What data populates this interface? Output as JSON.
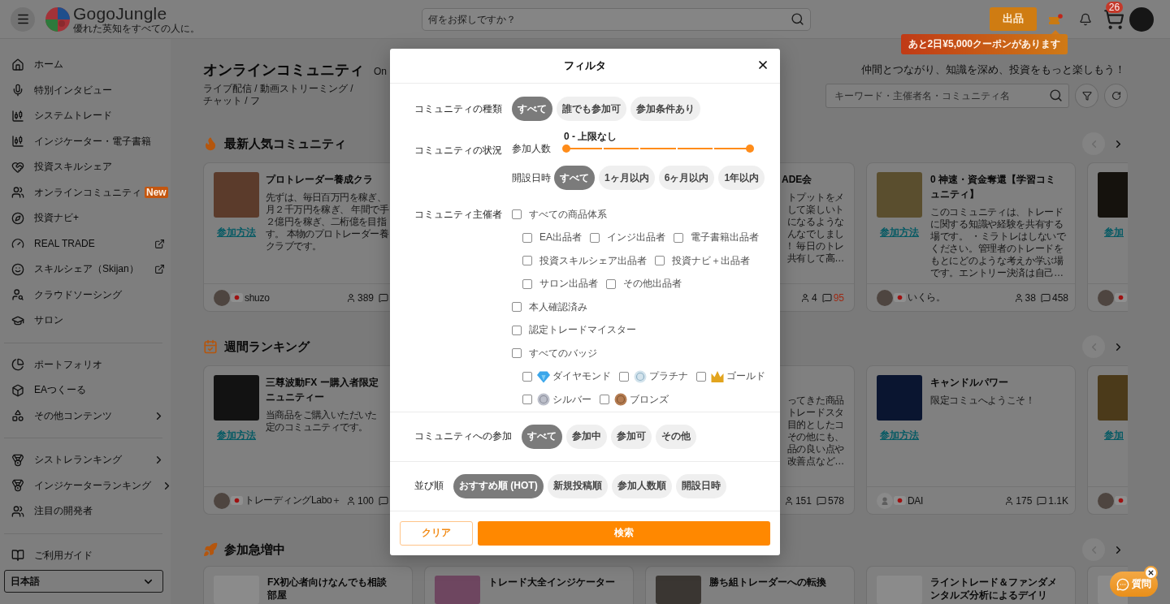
{
  "header": {
    "logo": "GogoJungle",
    "tagline": "優れた英知をすべての人に。",
    "search_placeholder": "何をお探しですか？",
    "sell_button": "出品",
    "coupon_alert": true,
    "cart_count": "26",
    "coupon_tooltip": "あと2日¥5,000クーポンがあります"
  },
  "sidebar": {
    "groups": [
      {
        "items": [
          {
            "label": "ホーム",
            "external": false,
            "submenu": false
          },
          {
            "label": "特別インタビュー",
            "external": false,
            "submenu": false
          },
          {
            "label": "システムトレード",
            "external": false,
            "submenu": false
          },
          {
            "label": "インジケーター・電子書籍",
            "external": false,
            "submenu": false
          },
          {
            "label": "投資スキルシェア",
            "external": false,
            "submenu": false
          },
          {
            "label": "オンラインコミュニティ",
            "badge": "New",
            "external": false,
            "submenu": false
          },
          {
            "label": "投資ナビ+",
            "external": false,
            "submenu": false
          },
          {
            "label": "REAL TRADE",
            "external": true,
            "submenu": false
          },
          {
            "label": "スキルシェア（Skijan）",
            "external": true,
            "submenu": false
          },
          {
            "label": "クラウドソーシング",
            "external": false,
            "submenu": false
          },
          {
            "label": "サロン",
            "external": false,
            "submenu": false
          }
        ]
      },
      {
        "items": [
          {
            "label": "ポートフォリオ",
            "external": false,
            "submenu": false
          },
          {
            "label": "EAつくーる",
            "external": false,
            "submenu": false
          },
          {
            "label": "その他コンテンツ",
            "external": false,
            "submenu": true
          }
        ]
      },
      {
        "items": [
          {
            "label": "シストレランキング",
            "external": false,
            "submenu": true
          },
          {
            "label": "インジケーターランキング",
            "external": false,
            "submenu": true
          },
          {
            "label": "注目の開発者",
            "external": false,
            "submenu": false
          }
        ]
      },
      {
        "items": [
          {
            "label": "ご利用ガイド",
            "external": false,
            "submenu": false
          }
        ]
      }
    ],
    "language": "日本語"
  },
  "page": {
    "title": "オンラインコミュニティ",
    "title_en": "On",
    "subtitle": "ライブ配信 / 動画ストリーミング / チャット / フ",
    "tagline": "仲間とつながり、知識を深め、投資をもっと楽しもう！",
    "search_placeholder": "キーワード・主催者名・コミュニティ名"
  },
  "sections": [
    {
      "title": "最新人気コミュニティ",
      "prev_disabled": true,
      "cards": [
        {
          "kind": "clip_right",
          "link": "参加方法",
          "title_lines": [
            "プロトレーダー養成クラ"
          ],
          "description_lines": [
            "先ずは、毎日百万円を稼ぎ、",
            "月２千万円を稼ぎ、 年間で手",
            "２億円を稼ぎ、二桁億を目指",
            "す。 本物のプロトレーダー養",
            "クラブです。"
          ],
          "avatar": true,
          "default_avatar": false,
          "author": "shuzo",
          "members": "389"
        },
        {
          "kind": "clip_left",
          "title_lines": [
            "ADE会"
          ],
          "description_lines": [
            "トプットをメ",
            "して楽しいト",
            "になるような",
            "んなでしまし",
            "！ 毎日のトレ",
            "共有して高…"
          ],
          "members": "4",
          "comments": "95",
          "comments_highlight": true
        },
        {
          "kind": "full",
          "link": "参加方法",
          "title_lines": [
            "0 神速・資金奪還【学習コミ",
            "ュニティ】"
          ],
          "description_lines": [
            "このコミュニティは、トレード",
            "に関する知識や経験を共有する",
            "場です。 ・ミラトレはしないで",
            "ください。管理者のトレードを",
            "もとにどのような考えか学ぶ場",
            "です。エントリー決済は自己…"
          ],
          "avatar": true,
          "default_avatar": false,
          "author": "いくら。",
          "members": "38",
          "comments": "458",
          "comments_highlight": false
        },
        {
          "kind": "edge",
          "link": "参加",
          "avatar": true,
          "default_avatar": false
        }
      ]
    },
    {
      "title": "週間ランキング",
      "prev_disabled": true,
      "cards": [
        {
          "kind": "clip_right",
          "link": "参加方法",
          "title_lines": [
            "三尊波動FX ー購入者限定",
            "ニュニティー"
          ],
          "description_lines": [
            "当商品をご購入いただいた",
            "定のコミュニティです。"
          ],
          "avatar": true,
          "default_avatar": false,
          "author": "トレーディングLabo＋",
          "members": "100"
        },
        {
          "kind": "clip_left",
          "description_lines": [
            "ってきた商品",
            "トレードスタ",
            "目的としたコ",
            "その他にも、",
            "品の良い点や",
            "改善点など…"
          ],
          "members": "151",
          "comments": "578",
          "comments_highlight": false
        },
        {
          "kind": "full",
          "link": "参加方法",
          "title_lines": [
            "キャンドルパワー"
          ],
          "description_lines": [
            "限定コミュへようこそ！"
          ],
          "avatar": true,
          "default_avatar": true,
          "author": "DAI",
          "members": "175",
          "comments": "1.1K",
          "comments_highlight": false
        },
        {
          "kind": "edge",
          "link": "参加",
          "avatar": true,
          "default_avatar": false
        }
      ]
    },
    {
      "title": "参加急増中",
      "prev_disabled": true,
      "cards": [
        {
          "kind": "full",
          "title_lines": [
            "FX初心者向けなんでも相談",
            "部屋"
          ]
        },
        {
          "kind": "full",
          "title_lines": [
            "トレード大全インジケーター"
          ]
        },
        {
          "kind": "full",
          "title_lines": [
            "勝ち組トレーダーへの転換"
          ]
        },
        {
          "kind": "full",
          "title_lines": [
            "ライントレード＆ファンダメ",
            "ンタルズ分析によるデイリ"
          ]
        },
        {
          "kind": "edge"
        }
      ]
    }
  ],
  "filter": {
    "title": "フィルタ",
    "sections": [
      {
        "kind": "chips",
        "label": "コミュニティの種類",
        "options": [
          {
            "label": "すべて",
            "selected": true
          },
          {
            "label": "誰でも参加可",
            "selected": false
          },
          {
            "label": "参加条件あり",
            "selected": false
          }
        ]
      },
      {
        "kind": "status",
        "label": "コミュニティの状況",
        "range": {
          "label": "参加人数",
          "reading": "0 - 上限なし",
          "thumbs": [
            {
              "level": 0
            },
            {
              "level": 1
            }
          ]
        },
        "date": {
          "label": "開設日時",
          "options": [
            {
              "label": "すべて",
              "selected": true
            },
            {
              "label": "1ヶ月以内",
              "selected": false
            },
            {
              "label": "6ヶ月以内",
              "selected": false
            },
            {
              "label": "1年以内",
              "selected": false
            }
          ]
        }
      },
      {
        "kind": "checkboxes",
        "label": "コミュニティ主催者",
        "items": [
          {
            "kind": "plain",
            "label": "すべての商品体系",
            "checked": false,
            "children": [
              {
                "kind": "plain",
                "label": "EA出品者",
                "checked": false
              },
              {
                "kind": "plain",
                "label": "インジ出品者",
                "checked": false
              },
              {
                "kind": "plain",
                "label": "電子書籍出品者",
                "checked": false
              },
              {
                "kind": "plain",
                "label": "投資スキルシェア出品者",
                "checked": false
              },
              {
                "kind": "plain",
                "label": "投資ナビ＋出品者",
                "checked": false
              },
              {
                "kind": "plain",
                "label": "サロン出品者",
                "checked": false
              },
              {
                "kind": "plain",
                "label": "その他出品者",
                "checked": false
              }
            ]
          },
          {
            "kind": "plain",
            "label": "本人確認済み",
            "checked": false
          },
          {
            "kind": "plain",
            "label": "認定トレードマイスター",
            "checked": false
          },
          {
            "kind": "plain",
            "label": "すべてのバッジ",
            "checked": false,
            "children": [
              {
                "kind": "badge",
                "label": "ダイヤモンド",
                "checked": false
              },
              {
                "kind": "badge",
                "label": "プラチナ",
                "checked": false
              },
              {
                "kind": "badge",
                "label": "ゴールド",
                "checked": false
              },
              {
                "kind": "badge",
                "label": "シルバー",
                "checked": false
              },
              {
                "kind": "badge",
                "label": "ブロンズ",
                "checked": false
              }
            ]
          }
        ]
      }
    ],
    "bars": [
      {
        "label": "コミュニティへの参加",
        "options": [
          {
            "label": "すべて",
            "selected": true
          },
          {
            "label": "参加中",
            "selected": false
          },
          {
            "label": "参加可",
            "selected": false
          },
          {
            "label": "その他",
            "selected": false
          }
        ]
      },
      {
        "label": "並び順",
        "options": [
          {
            "label": "おすすめ順 (HOT)",
            "selected": true
          },
          {
            "label": "新規投稿順",
            "selected": false
          },
          {
            "label": "参加人数順",
            "selected": false
          },
          {
            "label": "開設日時",
            "selected": false
          }
        ]
      }
    ],
    "clear_button": "クリア",
    "search_button": "検索"
  },
  "chat_button": {
    "label": "質問"
  }
}
